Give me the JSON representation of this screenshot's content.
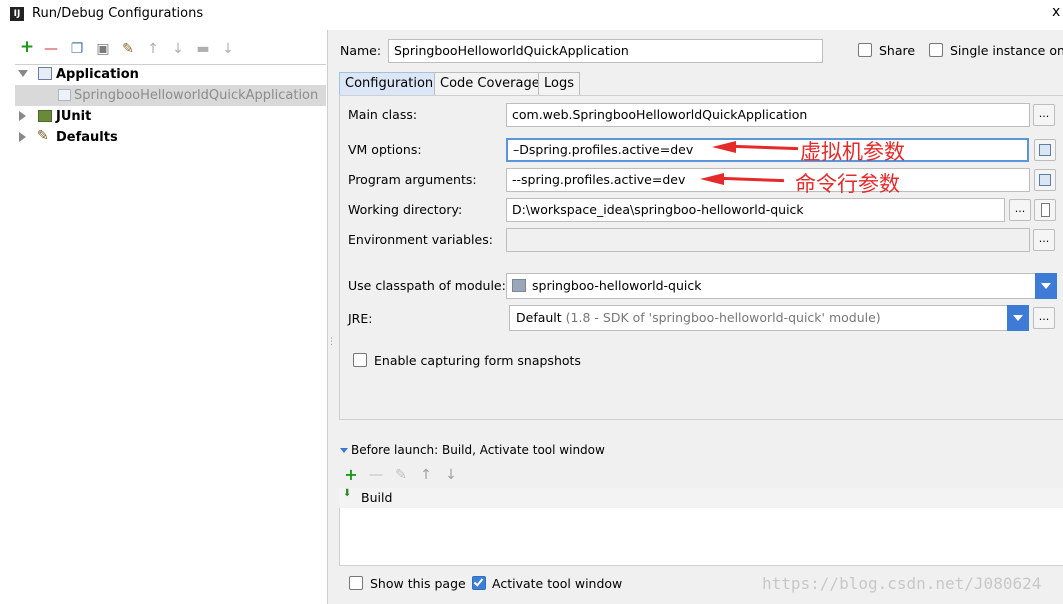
{
  "window": {
    "title": "Run/Debug Configurations",
    "icon": "intellij-icon",
    "close": "x"
  },
  "left_toolbar": {
    "icons": [
      {
        "name": "add-icon",
        "glyph": "+",
        "color": "#1a9a1a"
      },
      {
        "name": "remove-icon",
        "glyph": "—",
        "color": "#d03030"
      },
      {
        "name": "copy-icon",
        "glyph": "❐",
        "color": "#5577aa"
      },
      {
        "name": "save-icon",
        "glyph": "▣",
        "color": "#7a7a7a"
      },
      {
        "name": "wrench-icon",
        "glyph": "✎",
        "color": "#8a6a30"
      },
      {
        "name": "move-up-icon",
        "glyph": "↑",
        "color": "#b0b0b0"
      },
      {
        "name": "move-down-icon",
        "glyph": "↓",
        "color": "#b0b0b0"
      },
      {
        "name": "folder-icon",
        "glyph": "▬",
        "color": "#b0b0b0"
      },
      {
        "name": "sort-icon",
        "glyph": "↓",
        "color": "#b0b0b0"
      }
    ]
  },
  "tree": {
    "application": "Application",
    "app_child": "SpringbooHelloworldQuickApplication",
    "junit": "JUnit",
    "defaults": "Defaults"
  },
  "header": {
    "name_label": "Name:",
    "name_value": "SpringbooHelloworldQuickApplication",
    "share_label": "Share",
    "single_instance_label": "Single instance only"
  },
  "tabs": [
    "Configuration",
    "Code Coverage",
    "Logs"
  ],
  "config": {
    "main_class_label": "Main class:",
    "main_class_value": "com.web.SpringbooHelloworldQuickApplication",
    "vm_options_label": "VM options:",
    "vm_options_value": "–Dspring.profiles.active=dev",
    "program_args_label": "Program arguments:",
    "program_args_value": "--spring.profiles.active=dev",
    "working_dir_label": "Working directory:",
    "working_dir_value": "D:\\workspace_idea\\springboo-helloworld-quick",
    "env_vars_label": "Environment variables:",
    "env_vars_value": "",
    "classpath_label": "Use classpath of module:",
    "classpath_value": "springboo-helloworld-quick",
    "jre_label": "JRE:",
    "jre_value_main": "Default",
    "jre_value_detail": "(1.8 - SDK of 'springboo-helloworld-quick' module)",
    "enable_snapshots_label": "Enable capturing form snapshots",
    "dots": "..."
  },
  "annotations": {
    "vm_note": "虚拟机参数",
    "args_note": "命令行参数",
    "color": "#e52a2a"
  },
  "before_launch": {
    "title": "Before launch: Build, Activate tool window",
    "item": "Build"
  },
  "footer": {
    "show_page_label": "Show this page",
    "activate_tool_label": "Activate tool window",
    "activate_tool_checked": true,
    "show_page_checked": false
  },
  "watermark": "https://blog.csdn.net/J080624"
}
